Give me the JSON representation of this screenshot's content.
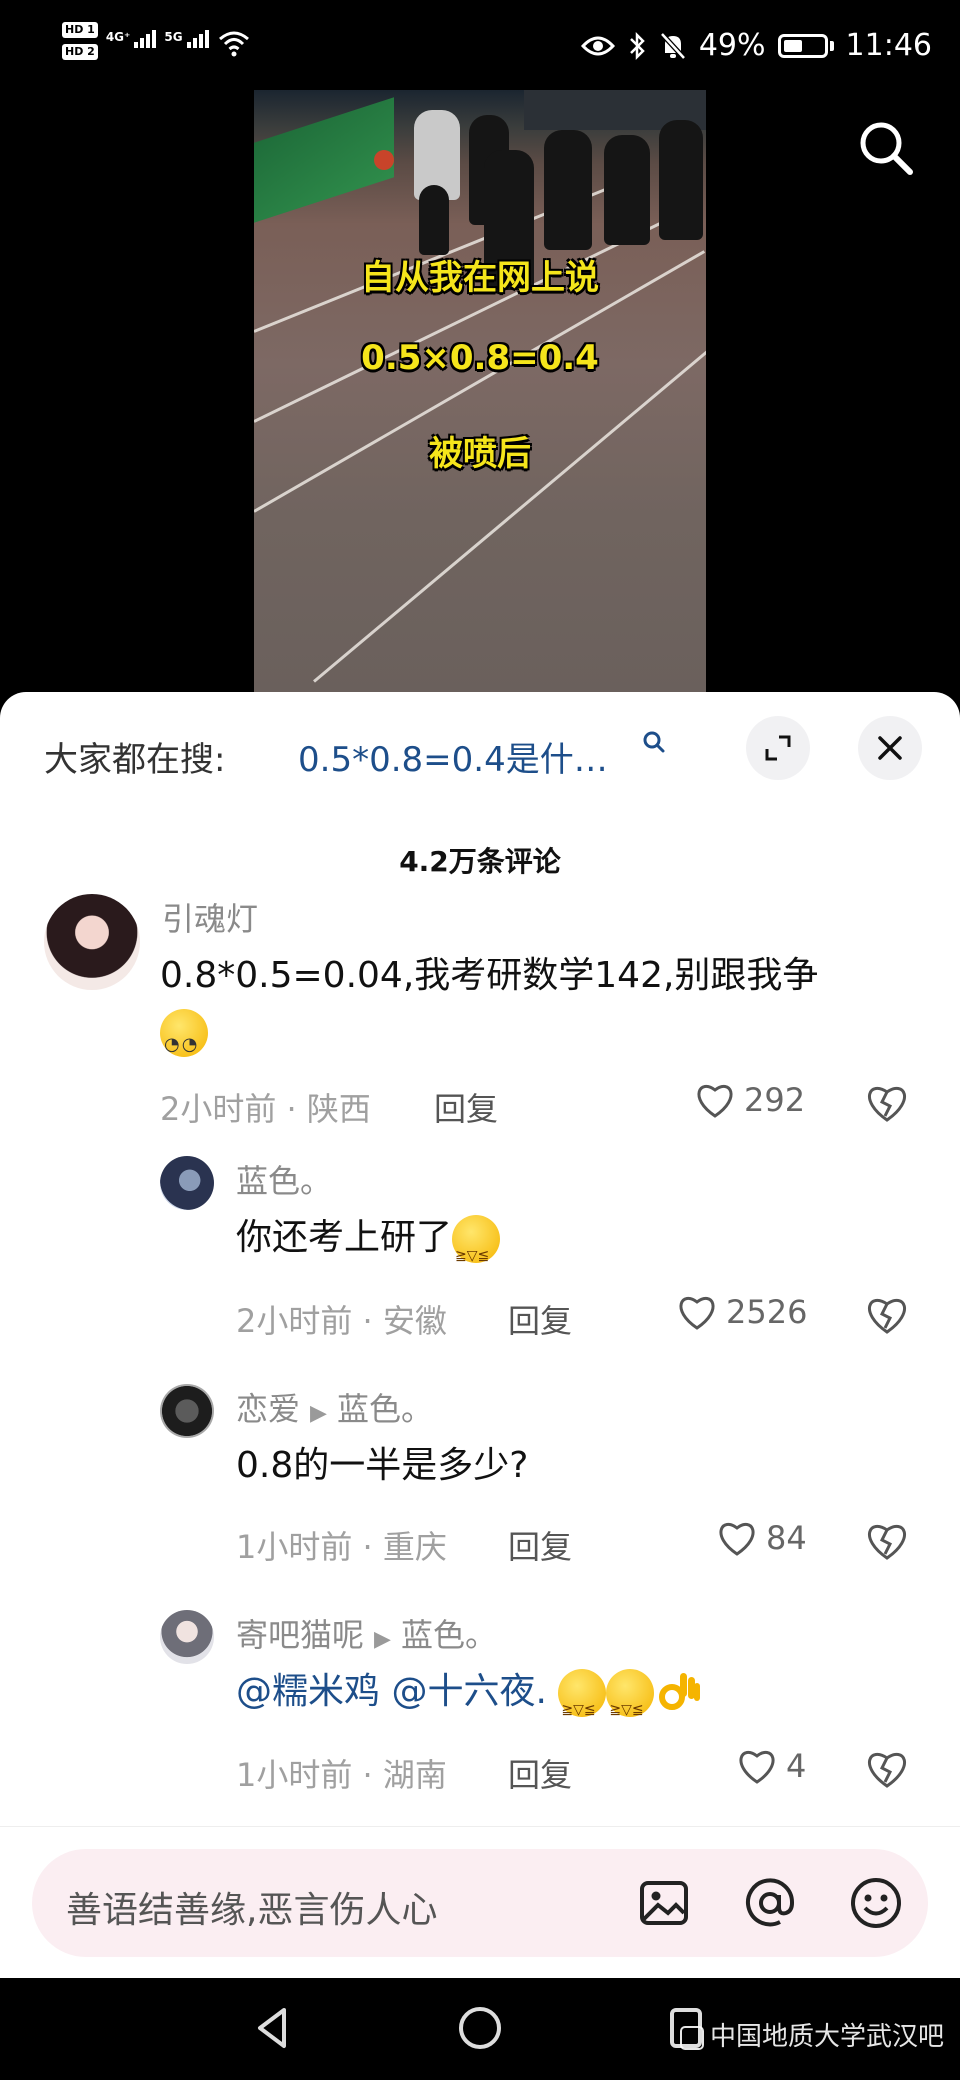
{
  "status_bar": {
    "hd1": "HD 1",
    "hd2": "HD 2",
    "net1": "4G⁺",
    "net2": "5G",
    "battery": "49%",
    "time": "11:46"
  },
  "video": {
    "caption_line1": "自从我在网上说",
    "caption_line2": "0.5×0.8=0.4",
    "caption_line3": "被喷后"
  },
  "search_suggest": {
    "label": "大家都在搜:",
    "query": "0.5*0.8=0.4是什…"
  },
  "comments_header": "4.2万条评论",
  "comments": [
    {
      "name": "引魂灯",
      "text": "0.8*0.5=0.04,我考研数学142,别跟我争",
      "meta": "2小时前 · 陕西",
      "reply_label": "回复",
      "likes": "292"
    },
    {
      "name": "蓝色。",
      "text": "你还考上研了",
      "meta": "2小时前 · 安徽",
      "reply_label": "回复",
      "likes": "2526"
    },
    {
      "name": "恋爱",
      "reply_to": "蓝色。",
      "text": "0.8的一半是多少?",
      "meta": "1小时前 · 重庆",
      "reply_label": "回复",
      "likes": "84"
    },
    {
      "name": "寄吧猫呢",
      "reply_to": "蓝色。",
      "text": "@糯米鸡 @十六夜.",
      "meta": "1小时前 · 湖南",
      "reply_label": "回复",
      "likes": "4"
    }
  ],
  "input": {
    "placeholder": "善语结善缘,恶言伤人心"
  },
  "watermark": "中国地质大学武汉吧"
}
